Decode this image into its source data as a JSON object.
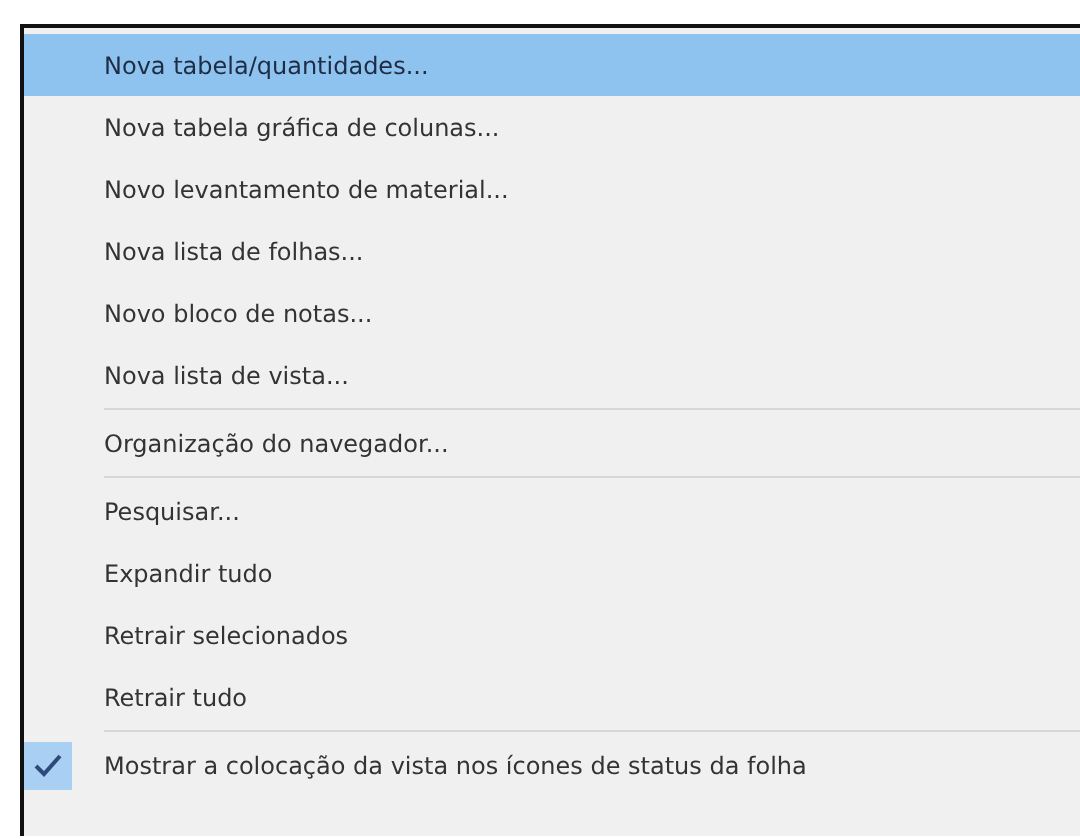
{
  "menu": {
    "groups": [
      {
        "items": [
          {
            "label": "Nova tabela/quantidades...",
            "selected": true
          },
          {
            "label": "Nova tabela gráfica de colunas...",
            "selected": false
          },
          {
            "label": "Novo levantamento de material...",
            "selected": false
          },
          {
            "label": "Nova lista de folhas...",
            "selected": false
          },
          {
            "label": "Novo bloco de notas...",
            "selected": false
          },
          {
            "label": "Nova lista de vista...",
            "selected": false
          }
        ]
      },
      {
        "items": [
          {
            "label": "Organização do navegador...",
            "selected": false
          }
        ]
      },
      {
        "items": [
          {
            "label": "Pesquisar...",
            "selected": false
          },
          {
            "label": "Expandir tudo",
            "selected": false
          },
          {
            "label": "Retrair selecionados",
            "selected": false
          },
          {
            "label": "Retrair tudo",
            "selected": false
          }
        ]
      },
      {
        "items": [
          {
            "label": "Mostrar a colocação da vista nos ícones de status da folha",
            "selected": false,
            "checked": true
          }
        ]
      }
    ]
  }
}
